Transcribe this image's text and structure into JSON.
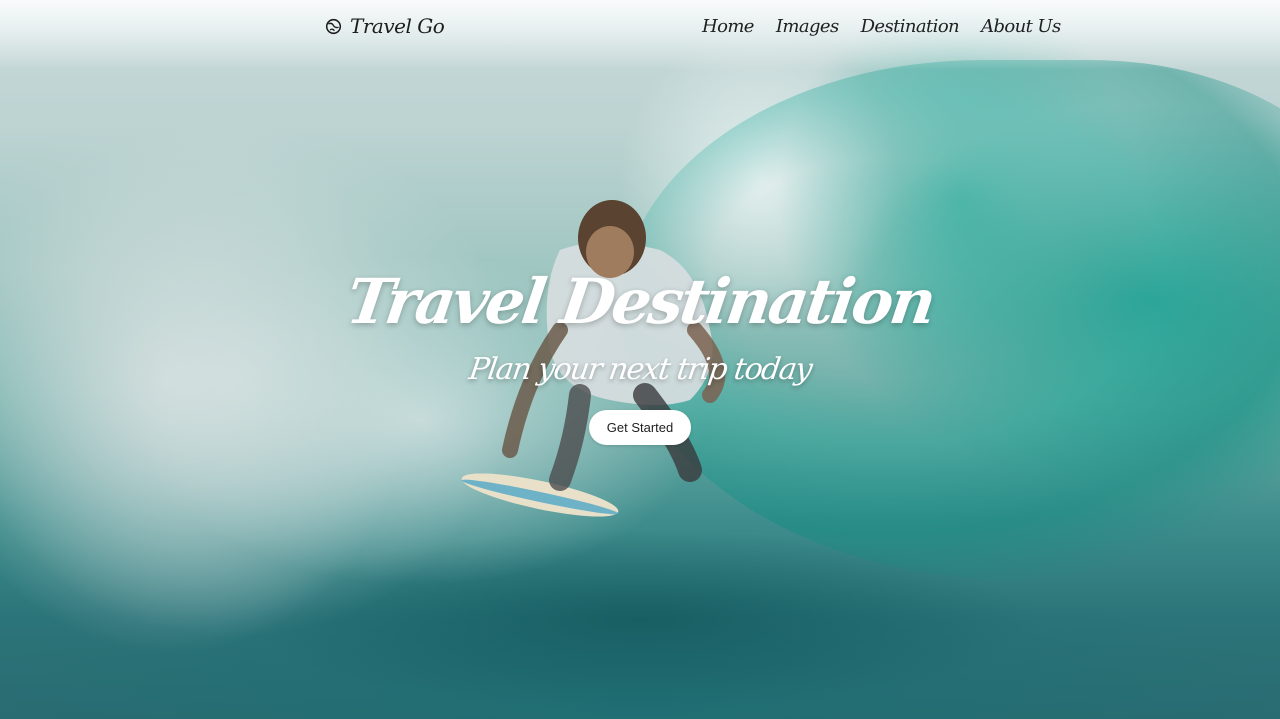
{
  "brand": {
    "name": "Travel Go",
    "icon": "globe-icon"
  },
  "nav": {
    "items": [
      {
        "label": "Home"
      },
      {
        "label": "Images"
      },
      {
        "label": "Destination"
      },
      {
        "label": "About Us"
      }
    ]
  },
  "hero": {
    "title": "Travel Destination",
    "subtitle": "Plan your next trip today",
    "cta_label": "Get Started"
  },
  "colors": {
    "wave_teal": "#1aa896",
    "deep_water": "#2a6c72",
    "text_dark": "#1d1d1d",
    "white": "#ffffff"
  }
}
